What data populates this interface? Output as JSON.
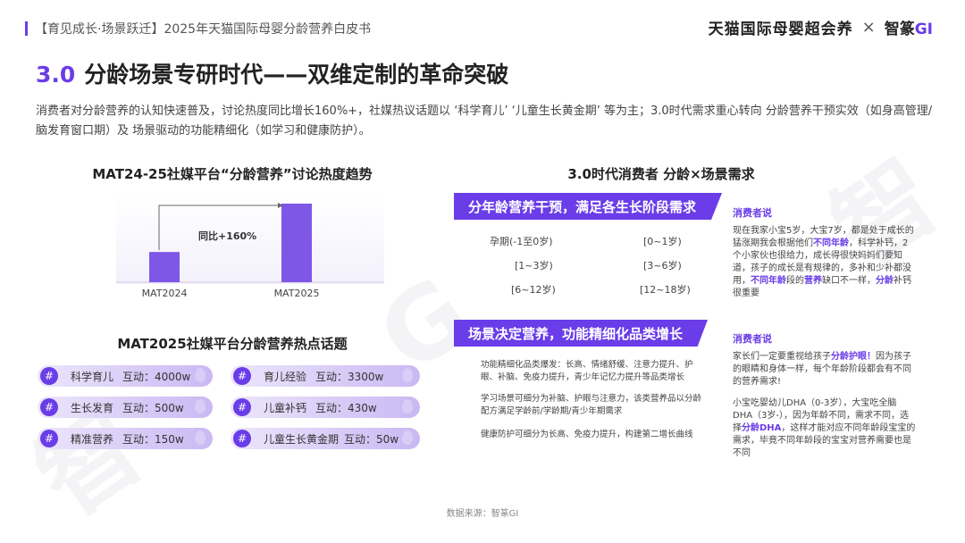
{
  "header": {
    "tag": "【育见成长·场景跃迁】2025年天猫国际母婴分龄营养白皮书",
    "logo_tmall": "天猫国际母婴超会养",
    "logo_x": "×",
    "logo_zhichou": "智篆",
    "logo_gi": "GI"
  },
  "title": {
    "num": "3.0",
    "text": "分龄场景专研时代——双维定制的革命突破"
  },
  "intro": "消费者对分龄营养的认知快速普及，讨论热度同比增长160%+，社媒热议话题以 ‘科学育儿’ ‘儿童生长黄金期’ 等为主；3.0时代需求重心转向 分龄营养干预实效（如身高管理/脑发育窗口期）及 场景驱动的功能精细化（如学习和健康防护）。",
  "left": {
    "chart_title": "MAT24-25社媒平台“分龄营养”讨论热度趋势",
    "topics_title": "MAT2025社媒平台分龄营养热点话题",
    "topics": [
      {
        "name": "科学育儿",
        "value": "互动：4000w"
      },
      {
        "name": "育儿经验",
        "value": "互动：3300w"
      },
      {
        "name": "生长发育",
        "value": "互动：500w"
      },
      {
        "name": "儿童补钙",
        "value": "互动：430w"
      },
      {
        "name": "精准营养",
        "value": "互动：150w"
      },
      {
        "name": "儿童生长黄金期",
        "value": "互动：50w"
      }
    ],
    "hash": "#"
  },
  "chart_data": {
    "type": "bar",
    "categories": [
      "MAT2024",
      "MAT2025"
    ],
    "values": [
      1,
      2.6
    ],
    "annotation": "同比+160%",
    "title": "MAT24-25社媒平台“分龄营养”讨论热度趋势",
    "xlabel": "",
    "ylabel": "",
    "colors": {
      "bar": "#7e57e6",
      "annotation": "#5a32d6"
    }
  },
  "right": {
    "title": "3.0时代消费者 分龄×场景需求",
    "banner1": "分年龄营养干预，满足各生长阶段需求",
    "ages": [
      "孕期(-1至0岁)",
      "[0~1岁)",
      "[1~3岁)",
      "[3~6岁)",
      "[6~12岁)",
      "[12~18岁)"
    ],
    "banner2": "场景决定营养，功能精细化品类增长",
    "scene_lines": [
      "功能精细化品类爆发：长高、情绪舒缓、注意力提升、护眼、补脑、免疫力提升，青少年记忆力提升等品类增长",
      "学习场景可细分为补脑、护眼与注意力，该类营养品以分龄配方满足学龄前/学龄期/青少年期需求",
      "健康防护可细分为长高、免疫力提升，构建第二增长曲线"
    ],
    "consumer_label": "消费者说",
    "quote1_a": "现在我家小宝5岁，大宝7岁，都是处于成长的猛涨期我会根据他们",
    "quote1_hl1": "不同年龄",
    "quote1_b": "，科学补钙，2个小家伙也很给力，成长得很快妈妈们要知道，孩子的成长是有规律的，多补和少补都没用，",
    "quote1_hl2": "不同年龄",
    "quote1_c": "段的",
    "quote1_hl3": "营养",
    "quote1_d": "缺口不一样，",
    "quote1_hl4": "分龄",
    "quote1_e": "补钙很重要",
    "quote2_a": "家长们一定要重视给孩子",
    "quote2_hl1": "分龄护眼！",
    "quote2_b": "因为孩子的眼睛和身体一样，每个年龄阶段都会有不同的营养需求!",
    "quote3_a": "小宝吃婴幼儿DHA（0-3岁），大宝吃全脑DHA（3岁-），因为年龄不同，需求不同，选择",
    "quote3_hl": "分龄DHA",
    "quote3_b": "，这样才能对应不同年龄段宝宝的需求，毕竟不同年龄段的宝宝对营养需要也是不同"
  },
  "footer": "数据来源：智篆GI"
}
